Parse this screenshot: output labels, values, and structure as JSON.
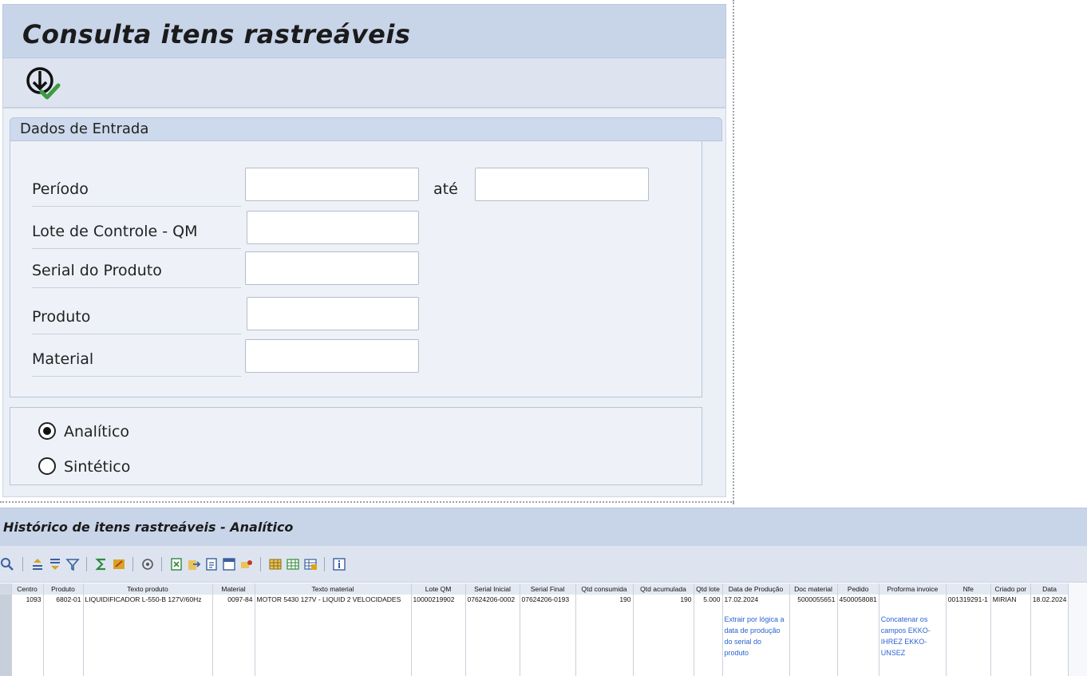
{
  "window1": {
    "title": "Consulta itens rastreáveis",
    "group_title": "Dados de Entrada",
    "fields": {
      "periodo_label": "Período",
      "ate_label": "até",
      "lote_label": "Lote de Controle - QM",
      "serial_label": "Serial do Produto",
      "produto_label": "Produto",
      "material_label": "Material"
    },
    "radios": {
      "analitico": "Analítico",
      "sintetico": "Sintético",
      "selected": "Analítico"
    }
  },
  "window2": {
    "title": "Histórico de itens rastreáveis - Analítico",
    "columns": [
      "Centro",
      "Produto",
      "Texto produto",
      "Material",
      "Texto material",
      "Lote QM",
      "Serial Inicial",
      "Serial Final",
      "Qtd consumida",
      "Qtd acumulada",
      "Qtd lote",
      "Data de Produção",
      "Doc material",
      "Pedido",
      "Proforma invoice",
      "Nfe",
      "Criado por",
      "Data"
    ],
    "row": {
      "centro": "1093",
      "produto": "6802-01",
      "texto_produto": "LIQUIDIFICADOR L-550-B 127V/60Hz",
      "material": "0097-84",
      "texto_material": "MOTOR 5430 127V - LIQUID 2 VELOCIDADES",
      "lote_qm": "10000219902",
      "serial_inicial": "07624206-0002",
      "serial_final": "07624206-0193",
      "qtd_consumida": "190",
      "qtd_acumulada": "190",
      "qtd_lote": "5.000",
      "data_producao": "17.02.2024",
      "doc_material": "5000055651",
      "pedido": "4500058081",
      "proforma": "",
      "nfe": "001319291-1",
      "criado_por": "MIRIAN",
      "data": "18.02.2024"
    },
    "notes": {
      "data_producao": "Extrair por lógica a data de produção do serial do produto",
      "proforma": "Concatenar os campos EKKO-IHREZ EKKO-UNSEZ"
    }
  }
}
